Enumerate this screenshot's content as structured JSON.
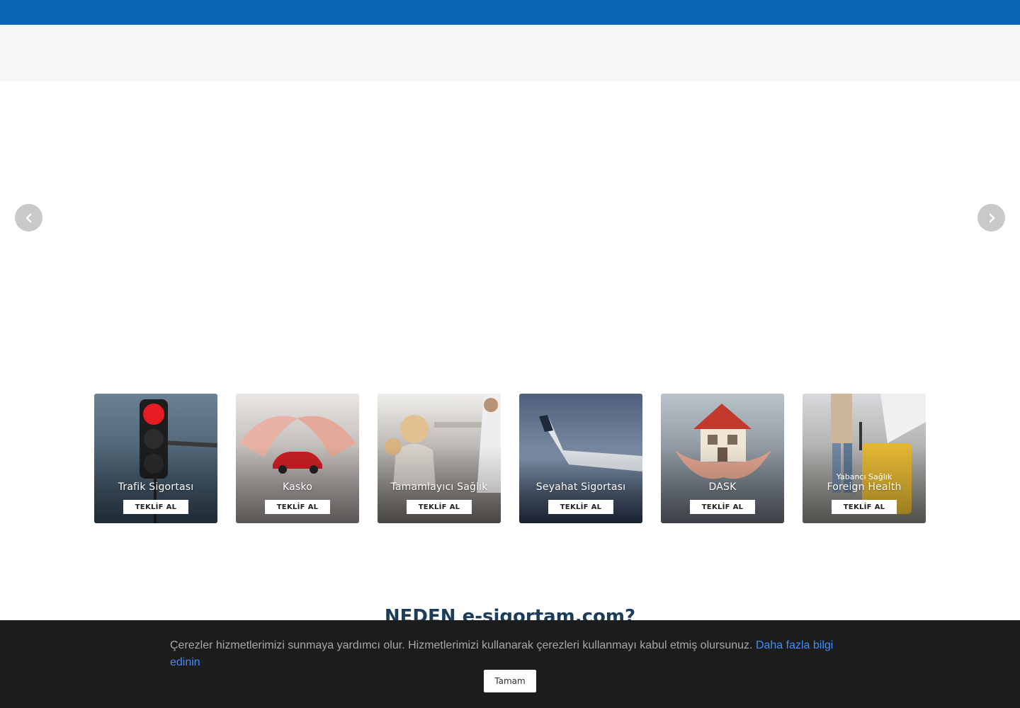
{
  "header": {
    "brand_color": "#0a66b5"
  },
  "slider": {
    "prev_icon": "chevron-left-icon",
    "next_icon": "chevron-right-icon"
  },
  "products": [
    {
      "title": "Trafik Sigortası",
      "subtitle": "",
      "cta": "TEKLİF AL",
      "image": "traffic-light-image"
    },
    {
      "title": "Kasko",
      "subtitle": "",
      "cta": "TEKLİF AL",
      "image": "hands-protecting-car-image"
    },
    {
      "title": "Tamamlayıcı Sağlık",
      "subtitle": "",
      "cta": "TEKLİF AL",
      "image": "family-doctor-image"
    },
    {
      "title": "Seyahat Sigortası",
      "subtitle": "",
      "cta": "TEKLİF AL",
      "image": "airplane-wing-image"
    },
    {
      "title": "DASK",
      "subtitle": "",
      "cta": "TEKLİF AL",
      "image": "hands-holding-house-image"
    },
    {
      "title": "Foreign Health",
      "subtitle": "Yabancı Sağlık",
      "cta": "TEKLİF AL",
      "image": "traveler-suitcase-image"
    }
  ],
  "why": {
    "title": "NEDEN e-sigortam.com?"
  },
  "cookie": {
    "text": "Çerezler hizmetlerimizi sunmaya yardımcı olur. Hizmetlerimizi kullanarak çerezleri kullanmayı kabul etmiş olursunuz. ",
    "link": "Daha fazla bilgi edinin",
    "ok": "Tamam",
    "link_color": "#3d8eff"
  }
}
